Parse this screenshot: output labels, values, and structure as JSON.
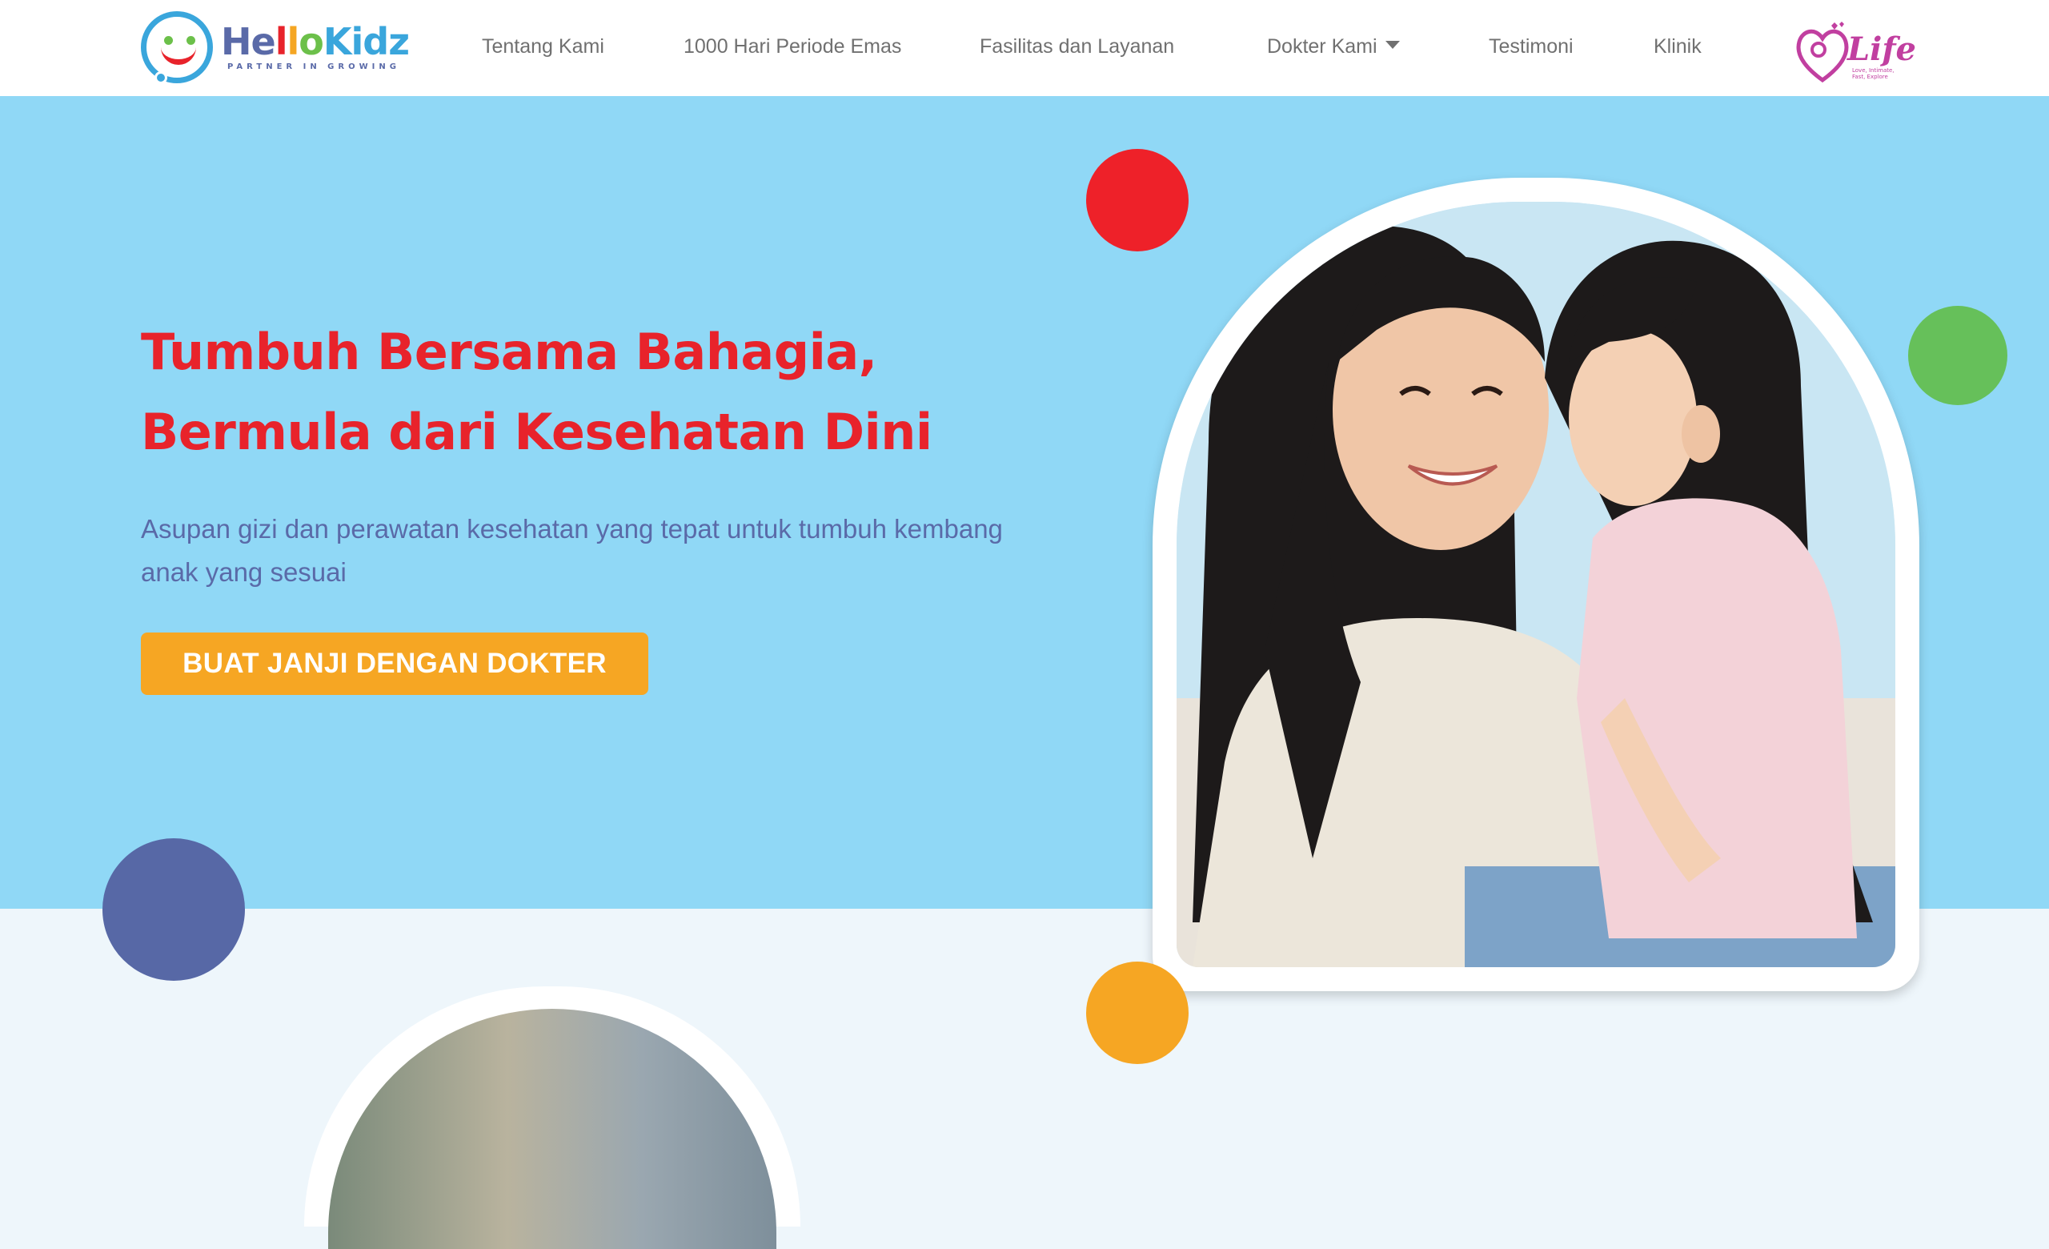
{
  "brand": {
    "name_parts": [
      "He",
      "l",
      "l",
      "o",
      "Kidz"
    ],
    "tagline": "PARTNER IN GROWING"
  },
  "nav": {
    "items": [
      {
        "label": "Tentang Kami"
      },
      {
        "label": "1000 Hari Periode Emas"
      },
      {
        "label": "Fasilitas dan Layanan"
      },
      {
        "label": "Dokter Kami"
      },
      {
        "label": "Testimoni"
      },
      {
        "label": "Klinik"
      }
    ]
  },
  "partner_logo": {
    "name": "Life",
    "sub": "Love, Intimate, Fast, Explore"
  },
  "hero": {
    "title_line1": "Tumbuh Bersama Bahagia,",
    "title_line2": "Bermula dari Kesehatan Dini",
    "subtitle": "Asupan gizi dan perawatan kesehatan yang tepat untuk tumbuh kembang anak yang sesuai",
    "cta_label": "BUAT JANJI DENGAN DOKTER"
  },
  "colors": {
    "hero_bg": "#90d8f6",
    "title": "#e8232b",
    "subtitle": "#5a6aa8",
    "cta": "#f6a623",
    "dot_red": "#ee2129",
    "dot_green": "#66c05a",
    "dot_blue": "#5768a6",
    "dot_yellow": "#f6a623"
  },
  "icons": {
    "dropdown": "caret-down-icon",
    "brand_mark": "smiley-face-icon",
    "partner_mark": "mother-baby-heart-icon"
  }
}
